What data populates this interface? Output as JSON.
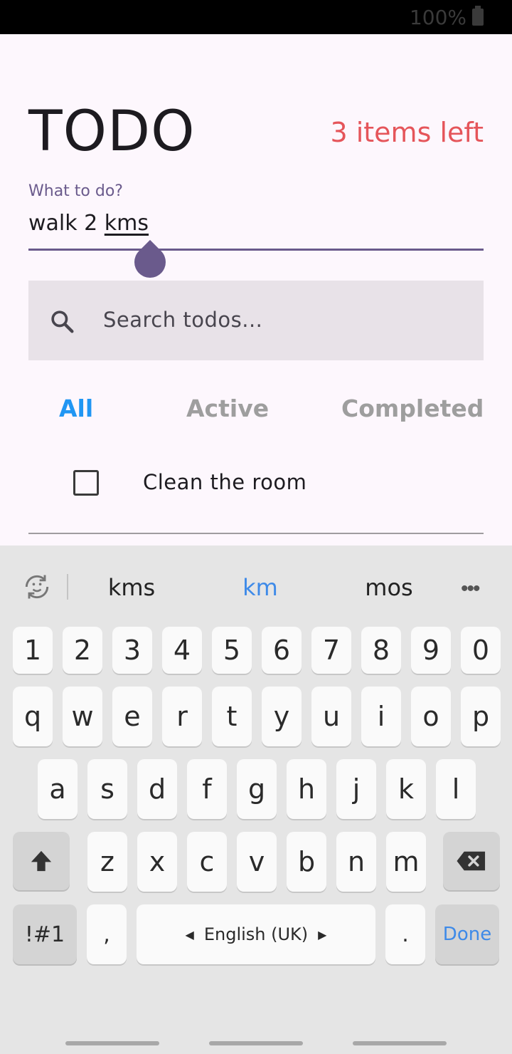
{
  "status": {
    "battery": "100%"
  },
  "header": {
    "title": "TODO",
    "items_left": "3 items left"
  },
  "input": {
    "label": "What to do?",
    "value_prefix": "walk 2 ",
    "value_underlined": "kms"
  },
  "search": {
    "placeholder": "Search todos..."
  },
  "filters": {
    "all": "All",
    "active": "Active",
    "completed": "Completed"
  },
  "todos": [
    {
      "text": "Clean the room",
      "checked": false
    }
  ],
  "keyboard": {
    "suggestions": [
      "kms",
      "km",
      "mos"
    ],
    "row_numbers": [
      "1",
      "2",
      "3",
      "4",
      "5",
      "6",
      "7",
      "8",
      "9",
      "0"
    ],
    "row_q": [
      "q",
      "w",
      "e",
      "r",
      "t",
      "y",
      "u",
      "i",
      "o",
      "p"
    ],
    "row_a": [
      "a",
      "s",
      "d",
      "f",
      "g",
      "h",
      "j",
      "k",
      "l"
    ],
    "row_z": [
      "z",
      "x",
      "c",
      "v",
      "b",
      "n",
      "m"
    ],
    "symbols": "!#1",
    "comma": ",",
    "space": "English (UK)",
    "period": ".",
    "done": "Done"
  },
  "colors": {
    "accent": "#6a5a8c",
    "items_left": "#e5555a",
    "tab_selected": "#2196f3",
    "suggestion_highlight": "#3e8ae8"
  }
}
